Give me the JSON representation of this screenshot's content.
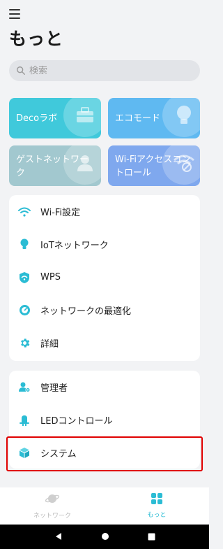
{
  "header": {
    "title": "もっと"
  },
  "search": {
    "placeholder": "検索"
  },
  "tiles": [
    {
      "label": "Decoラボ",
      "icon": "toolbox-icon",
      "color": "#40c9db"
    },
    {
      "label": "エコモード",
      "icon": "lightbulb-icon",
      "color": "#5fb9f1"
    },
    {
      "label": "ゲストネットワーク",
      "icon": "guest-user-icon",
      "color": "#a2c8cf"
    },
    {
      "label": "Wi-Fiアクセスコントロール",
      "icon": "wifi-blocked-icon",
      "color": "#7fa8ee"
    }
  ],
  "menu1": [
    {
      "label": "Wi-Fi設定",
      "icon": "wifi-icon"
    },
    {
      "label": "IoTネットワーク",
      "icon": "bulb-icon"
    },
    {
      "label": "WPS",
      "icon": "wps-shield-icon"
    },
    {
      "label": "ネットワークの最適化",
      "icon": "optimize-icon"
    },
    {
      "label": "詳細",
      "icon": "gear-icon"
    }
  ],
  "menu2": [
    {
      "label": "管理者",
      "icon": "admin-icon"
    },
    {
      "label": "LEDコントロール",
      "icon": "led-icon"
    },
    {
      "label": "システム",
      "icon": "cube-icon"
    }
  ],
  "nav": [
    {
      "label": "ネットワーク",
      "icon": "planet-icon",
      "active": false
    },
    {
      "label": "もっと",
      "icon": "grid-icon",
      "active": true
    }
  ],
  "colors": {
    "accent": "#2bbcd4",
    "highlight": "#e00000"
  }
}
